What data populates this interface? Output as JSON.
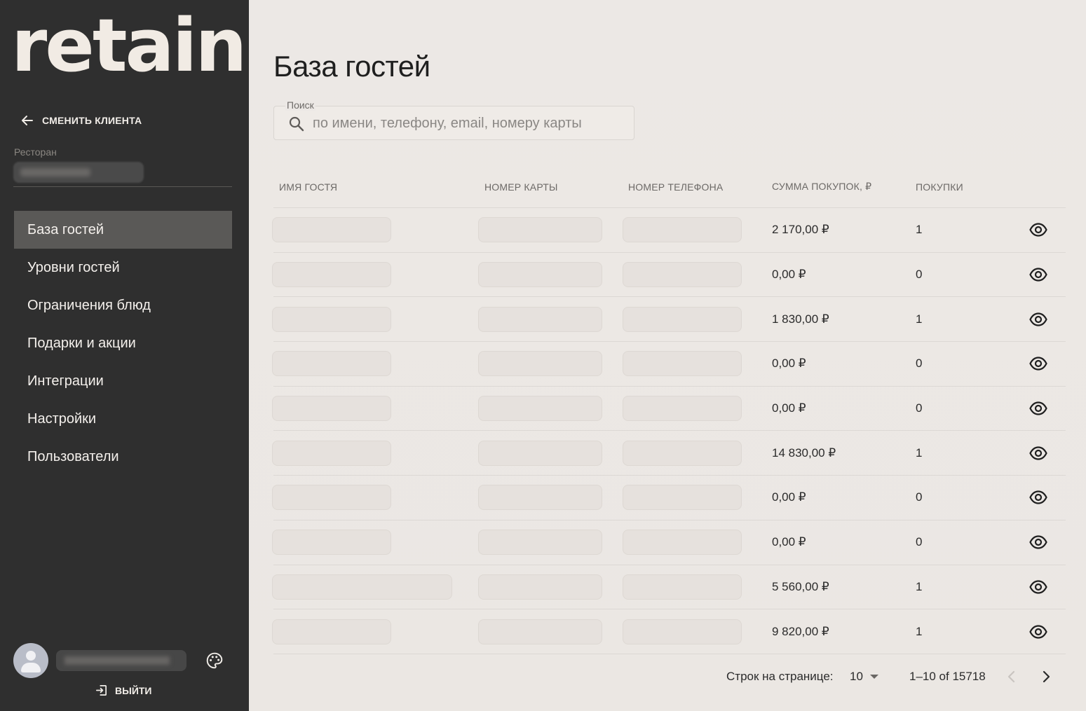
{
  "sidebar": {
    "logo": "retain",
    "switch_client": "СМЕНИТЬ КЛИЕНТА",
    "restaurant_label": "Ресторан",
    "restaurant_value": "",
    "nav": [
      {
        "label": "База гостей",
        "active": true
      },
      {
        "label": "Уровни гостей"
      },
      {
        "label": "Ограничения блюд"
      },
      {
        "label": "Подарки и акции"
      },
      {
        "label": "Интеграции"
      },
      {
        "label": "Настройки"
      },
      {
        "label": "Пользователи"
      }
    ],
    "user_name": "",
    "logout": "ВЫЙТИ"
  },
  "main": {
    "title": "База гостей",
    "search": {
      "legend": "Поиск",
      "placeholder": "по имени, телефону, email, номеру карты",
      "value": ""
    },
    "table": {
      "columns": [
        "ИМЯ ГОСТЯ",
        "НОМЕР КАРТЫ",
        "НОМЕР ТЕЛЕФОНА",
        "СУММА ПОКУПОК, ₽",
        "ПОКУПКИ"
      ],
      "rows": [
        {
          "name": "",
          "card": "",
          "phone": "",
          "sum": "2 170,00 ₽",
          "purchases": "1"
        },
        {
          "name": "",
          "card": "",
          "phone": "",
          "sum": "0,00 ₽",
          "purchases": "0"
        },
        {
          "name": "",
          "card": "",
          "phone": "",
          "sum": "1 830,00 ₽",
          "purchases": "1"
        },
        {
          "name": "",
          "card": "",
          "phone": "",
          "sum": "0,00 ₽",
          "purchases": "0"
        },
        {
          "name": "",
          "card": "",
          "phone": "",
          "sum": "0,00 ₽",
          "purchases": "0"
        },
        {
          "name": "",
          "card": "",
          "phone": "",
          "sum": "14 830,00 ₽",
          "purchases": "1"
        },
        {
          "name": "",
          "card": "",
          "phone": "",
          "sum": "0,00 ₽",
          "purchases": "0"
        },
        {
          "name": "",
          "card": "",
          "phone": "",
          "sum": "0,00 ₽",
          "purchases": "0"
        },
        {
          "name": "",
          "card": "",
          "phone": "",
          "sum": "5 560,00 ₽",
          "purchases": "1"
        },
        {
          "name": "",
          "card": "",
          "phone": "",
          "sum": "9 820,00 ₽",
          "purchases": "1"
        }
      ]
    },
    "pagination": {
      "rows_per_page_label": "Строк на странице:",
      "rows_per_page": "10",
      "range": "1–10 of 15718"
    }
  },
  "icons": {
    "back": "arrow-left-icon",
    "search": "search-icon",
    "view": "eye-icon",
    "user": "avatar-icon",
    "theme": "palette-icon",
    "logout": "logout-icon",
    "prev": "chevron-left-icon",
    "next": "chevron-right-icon"
  },
  "colors": {
    "sidebar_bg": "#2f2f2f",
    "active_nav_bg": "#5a5957",
    "main_bg": "#ebe7e3",
    "name_redacted": "#e8956a"
  }
}
